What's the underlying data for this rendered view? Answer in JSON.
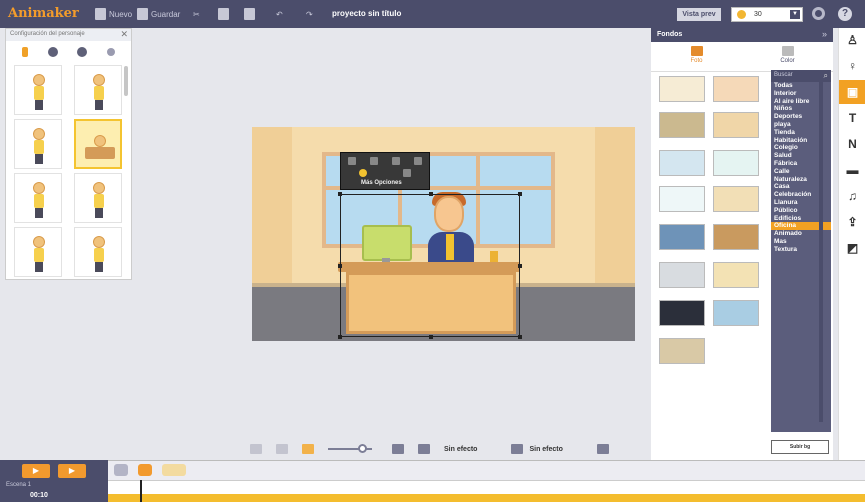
{
  "app": {
    "logo": "Animaker",
    "project_title": "proyecto sin título"
  },
  "toolbar": {
    "new_label": "Nuevo",
    "save_label": "Guardar",
    "preview_label": "Vista prev",
    "zoom_value": "30"
  },
  "character_panel": {
    "title": "Configuración del personaje"
  },
  "context_menu": {
    "label": "Más Opciones"
  },
  "bottom_tools": {
    "effect_in": "Sin efecto",
    "effect_out": "Sin efecto"
  },
  "backgrounds_panel": {
    "title": "Fondos",
    "tabs": [
      {
        "label": "Foto"
      },
      {
        "label": "Color"
      }
    ],
    "search_placeholder": "Buscar",
    "categories": [
      "Todas",
      "Interior",
      "Al aire libre",
      "Niños",
      "Deportes",
      "playa",
      "Tienda",
      "Habitación",
      "Colegio",
      "Salud",
      "Fábrica",
      "Calle",
      "Naturaleza",
      "Casa",
      "Celebración",
      "Llanura",
      "Público",
      "Edificios",
      "Oficina",
      "Animado",
      "Mas",
      "Textura"
    ],
    "active_category": "Oficina",
    "submit_label": "Subir bg"
  },
  "timeline": {
    "scene_label": "Escena 1",
    "timecode": "00:10"
  },
  "colors": {
    "accent": "#f2a123",
    "topbar": "#4b4d6b"
  }
}
